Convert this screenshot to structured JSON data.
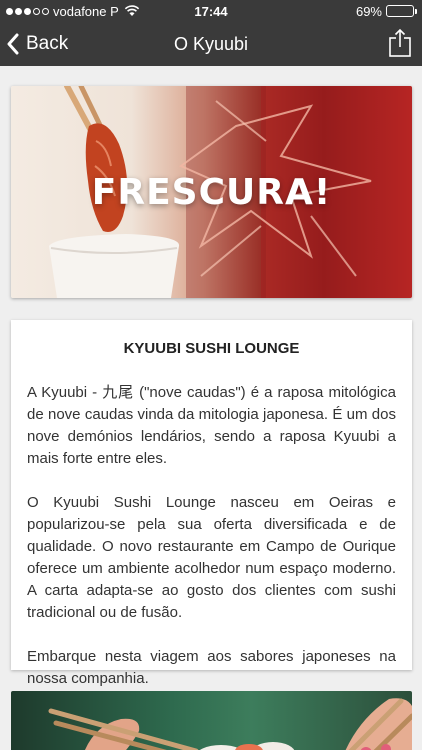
{
  "status_bar": {
    "carrier": "vodafone P",
    "time": "17:44",
    "battery": "69%",
    "battery_level": 0.69,
    "icons": [
      "signal-dots",
      "wifi-icon",
      "battery-icon"
    ]
  },
  "nav": {
    "back_label": "Back",
    "title": "O Kyuubi",
    "icons": [
      "chevron-left-icon",
      "share-icon"
    ]
  },
  "hero": {
    "caption": "FRESCURA!"
  },
  "card": {
    "heading": "KYUUBI SUSHI LOUNGE",
    "paragraphs": [
      "A Kyuubi - 九尾 (\"nove caudas\") é a raposa mitológica de nove caudas vinda da mitologia japonesa. É um dos nove demónios lendários, sendo a raposa Kyuubi a mais forte entre eles.",
      "O Kyuubi Sushi Lounge nasceu em Oeiras e popularizou-se pela sua oferta diversificada e de qualidade. O novo restaurante em Campo de Ourique oferece um ambiente acolhedor num espaço moderno. A carta adapta-se ao gosto dos clientes com sushi tradicional ou de fusão.",
      "Embarque nesta viagem aos sabores japoneses na nossa companhia."
    ]
  },
  "colors": {
    "bar_background": "#3a3a3a",
    "page_background": "#efefef",
    "battery_fill": "#4cd964"
  }
}
